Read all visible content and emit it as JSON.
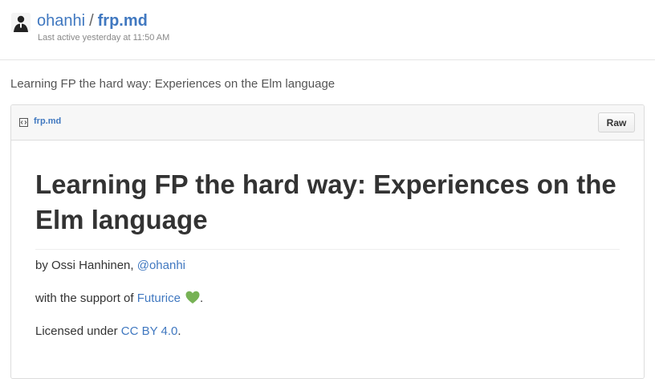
{
  "gist": {
    "owner": "ohanhi",
    "separator": "/",
    "filename": "frp.md",
    "last_active": "Last active yesterday at 11:50 AM",
    "description": "Learning FP the hard way: Experiences on the Elm language"
  },
  "file": {
    "name": "frp.md",
    "raw_label": "Raw",
    "icon": "file-code-icon"
  },
  "readme": {
    "heading": "Learning FP the hard way: Experiences on the Elm language",
    "byline_prefix": "by Ossi Hanhinen, ",
    "byline_link": "@ohanhi",
    "support_prefix": "with the support of ",
    "support_link": "Futurice",
    "support_icon": "green-heart-icon",
    "support_suffix": ".",
    "license_prefix": "Licensed under ",
    "license_link": "CC BY 4.0",
    "license_suffix": "."
  },
  "colors": {
    "link": "#4078c0",
    "heart": "#77b255"
  }
}
